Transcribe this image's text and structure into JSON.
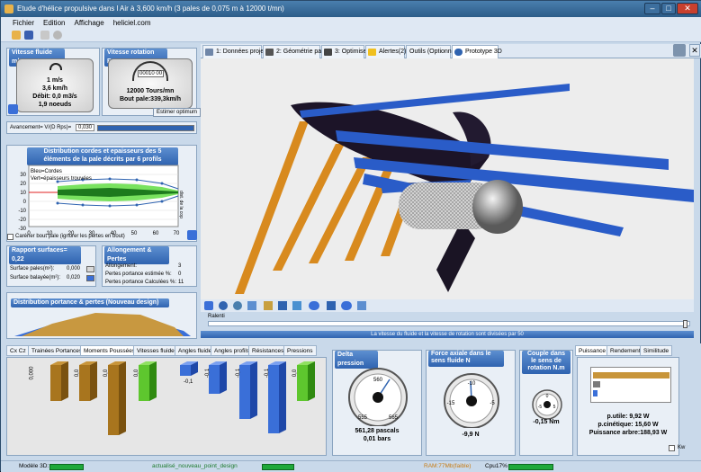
{
  "window": {
    "title": "Etude d'hélice propulsive dans l Air à 3,600 km/h (3 pales de 0,075 m à 12000 t/mn)"
  },
  "menu": [
    "Fichier",
    "Edition",
    "Affichage",
    "heliciel.com"
  ],
  "left": {
    "vitesse_fluide": {
      "title": "Vitesse fluide m/s",
      "line1": "1 m/s",
      "line2": "3,6 km/h",
      "line3": "Débit: 0,0 m3/s",
      "line4": "1,9 noeuds"
    },
    "vitesse_rotation": {
      "title": "Vitesse rotation Rpm",
      "counter": "00010 00",
      "line1": "12000 Tours/mn",
      "line2": "Bout pale:339,3km/h",
      "button": "Estimer optimum"
    },
    "avancement": {
      "label": "Avancement= V/(D Rps)=",
      "value": "0,030"
    },
    "distribution": {
      "title": "Distribution cordes et epaisseurs des 5 éléments de la pale décrits par 6 profils",
      "legend1": "Bleu=Cordes",
      "legend2": "Vert=épaisseurs trouvées",
      "yticks": [
        "30",
        "20",
        "10",
        "0",
        "-10",
        "-20",
        "-30"
      ],
      "xticks": [
        "0",
        "10",
        "20",
        "30",
        "40",
        "50",
        "60",
        "70"
      ],
      "right_label": "dist. de la cop",
      "checkbox": "Caréner bout pale (ignorer les pertes en bout)"
    },
    "rapport": {
      "title": "Rapport surfaces= 0,22",
      "surface_pales_label": "Surface pales(m²):",
      "surface_pales": "0,000",
      "surface_balayee_label": "Surface balayée(m²):",
      "surface_balayee": "0,020"
    },
    "allongement": {
      "title": "Allongement & Pertes",
      "allongement_label": "Allongement:",
      "allongement": "3",
      "pertes_est_label": "Pertes portance estimée %:",
      "pertes_est": "0",
      "pertes_calc_label": "Pertes portance Calculées %:",
      "pertes_calc": "11"
    },
    "portance": {
      "title": "Distribution portance & pertes (Nouveau design)"
    }
  },
  "tabs": [
    "1: Données projet",
    "2: Géométrie pale",
    "3: Optimiser",
    "Alertes(2)",
    "Outils (Optionnel)",
    "Prototype 3D"
  ],
  "view": {
    "ralenti": "Ralenti",
    "info": "La vitesse du fluide et la vitesse de rotation sont divisées par 50"
  },
  "bottom_tabs": [
    "Cx Cz",
    "Trainées Portances",
    "Moments Poussées",
    "Vitesses fluide",
    "Angles fluide",
    "Angles profils",
    "Résistances",
    "Pressions"
  ],
  "bars": [
    {
      "label": "0,000"
    },
    {
      "label": "0,0"
    },
    {
      "label": "0,0"
    },
    {
      "label": "0,0"
    },
    {
      "label": "-0,1"
    },
    {
      "label": "-0,1"
    },
    {
      "label": "-0,1"
    },
    {
      "label": "-0,1"
    },
    {
      "label": "0,0"
    }
  ],
  "delta_pression": {
    "title": "Delta pression",
    "ticks": [
      "560",
      "555",
      "565"
    ],
    "line1": "561,28 pascals",
    "line2": "0,01 bars"
  },
  "force_axiale": {
    "title": "Force axiale dans le sens fluide N",
    "ticks": [
      "-10",
      "-15",
      "-5"
    ],
    "value": "-9,9 N"
  },
  "couple": {
    "title": "Couple dans le sens de rotation N.m",
    "ticks": [
      "0",
      "-5",
      "5"
    ],
    "value": "-0,15 Nm"
  },
  "puissance": {
    "tabs": [
      "Puissance",
      "Rendement",
      "Similitude"
    ],
    "line1": "p.utile: 9,92 W",
    "line2": "p.cinétique: 15,60 W",
    "line3": "Puissance arbre:188,93 W",
    "checkbox": "Kw"
  },
  "status": {
    "modele": "Modèle 3D:",
    "design": "actualisé_nouveau_point_design",
    "ram": "RAM:77Mb(faible)",
    "cpu": "Cpu17%"
  },
  "colors": {
    "accent": "#2f63b0",
    "blade_orange": "#d88a1e",
    "blade_blue": "#2a5cc8",
    "bar_brown": "#a8751e",
    "bar_green": "#5ec62e",
    "bar_blue": "#3a6fd8"
  }
}
